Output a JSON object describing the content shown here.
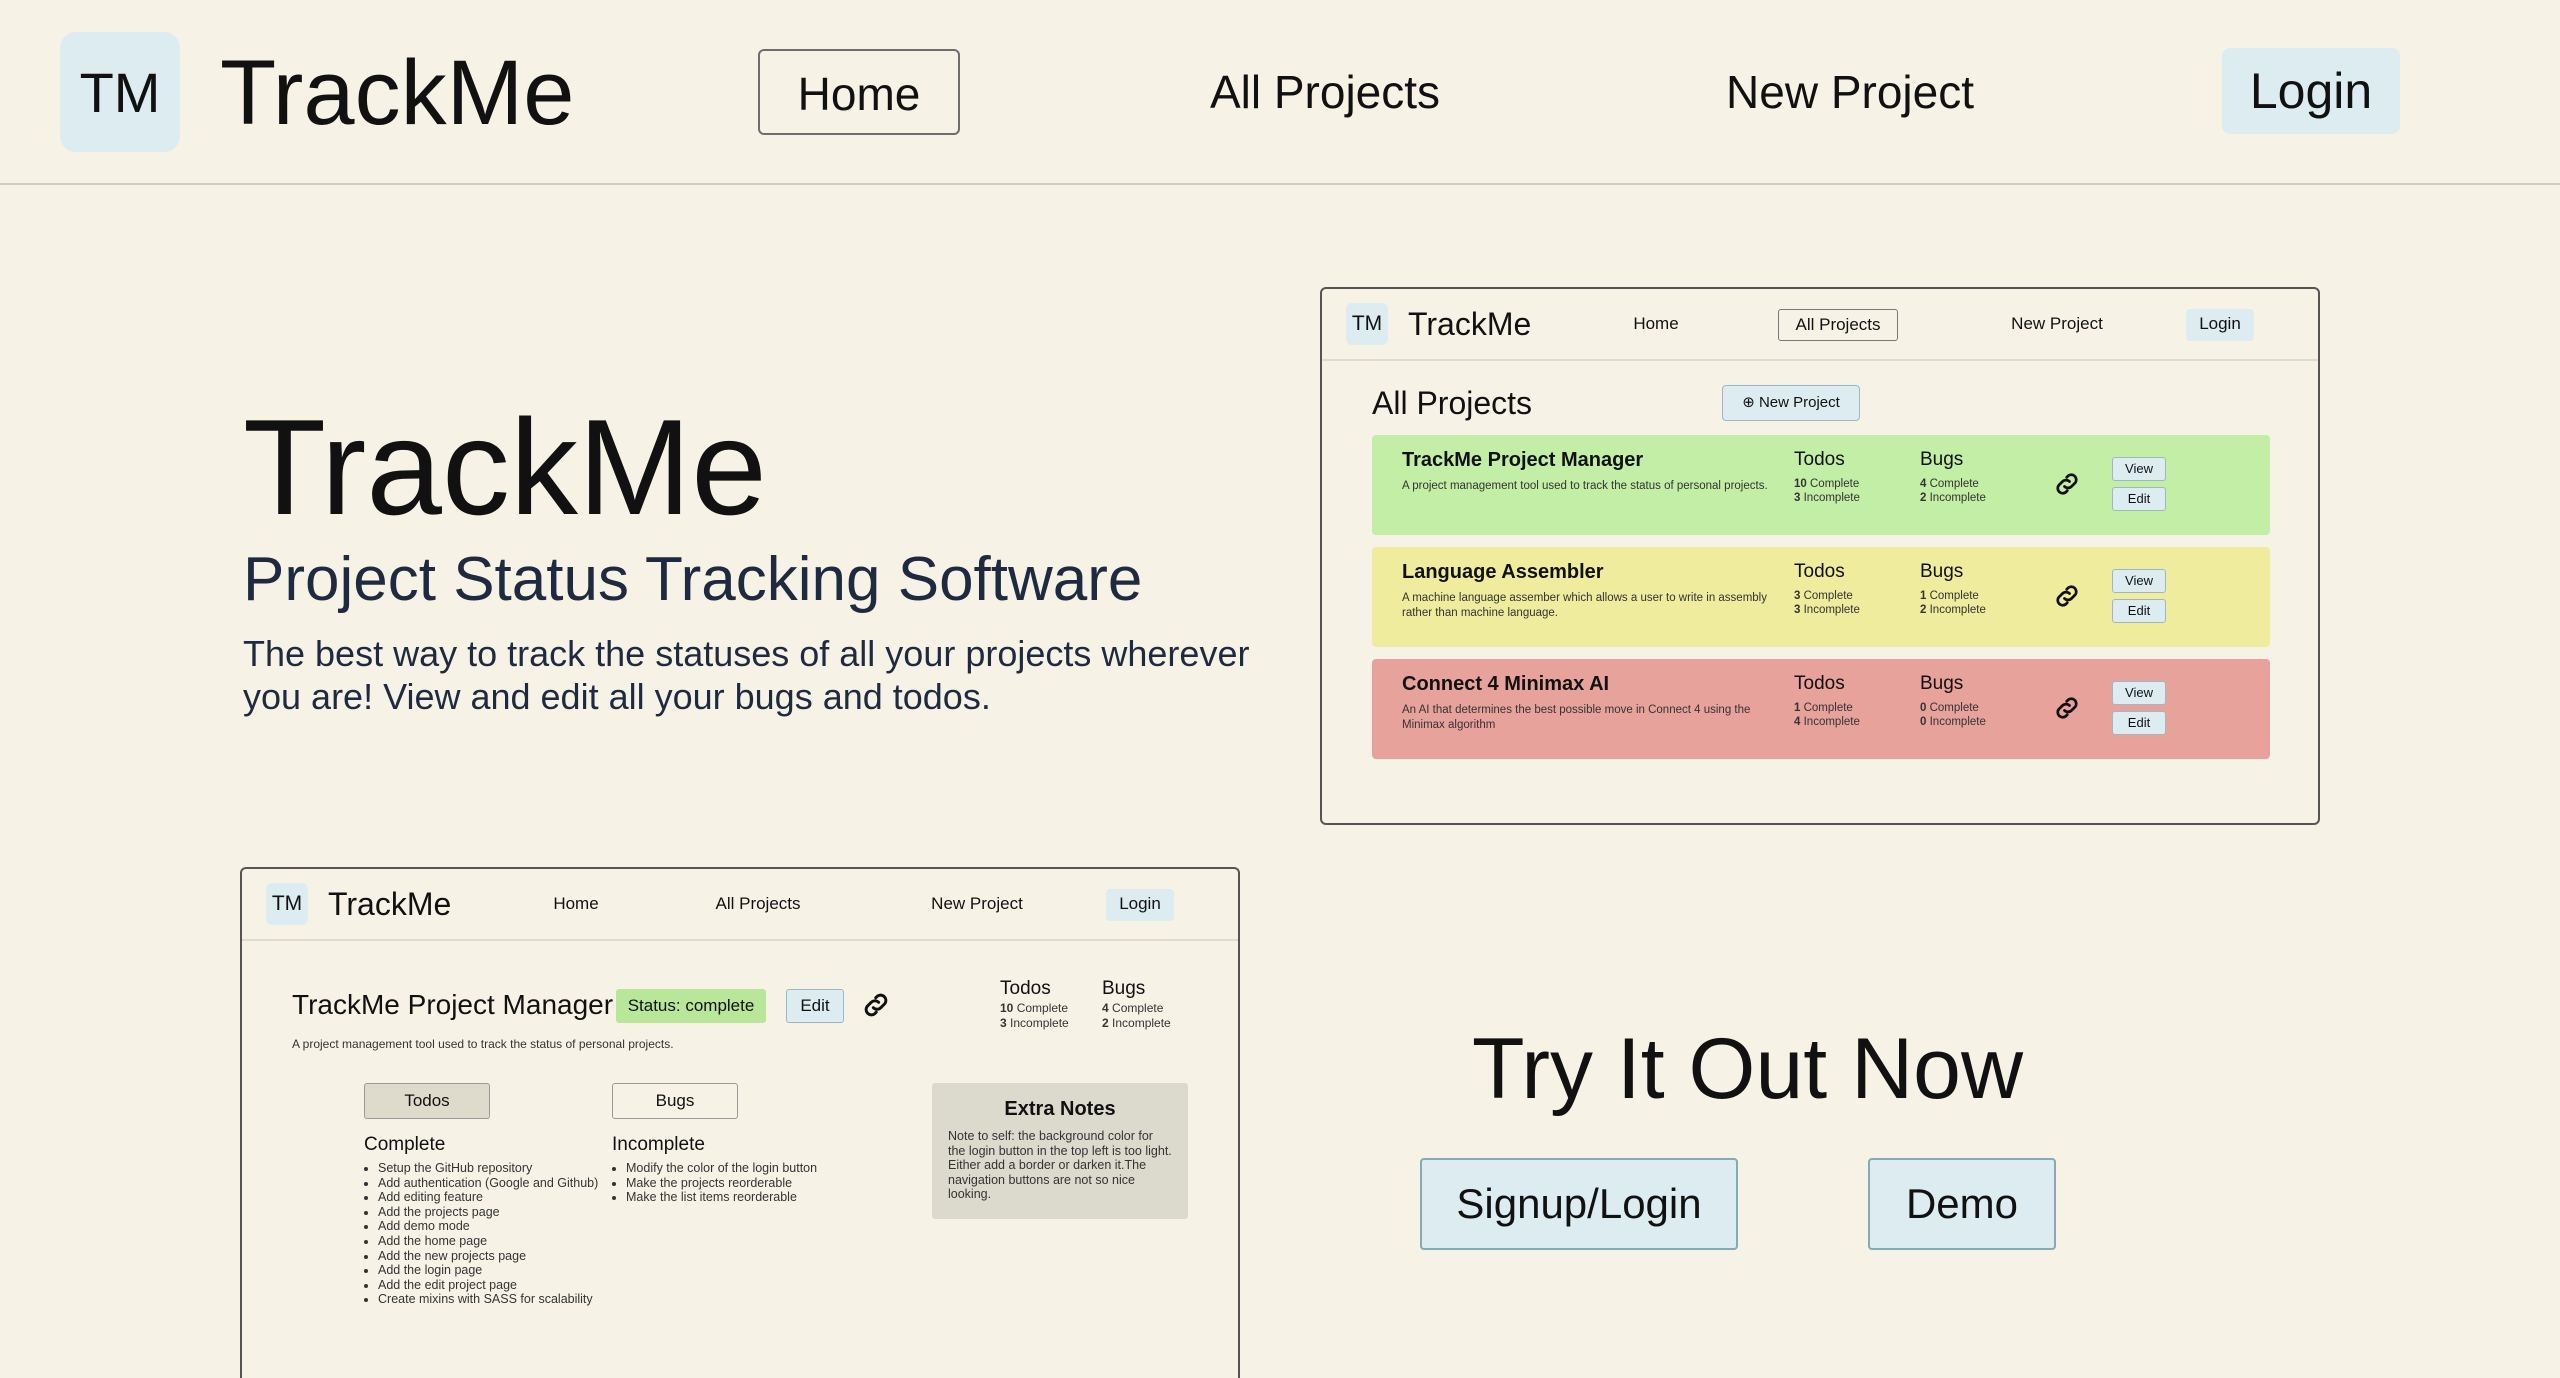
{
  "nav": {
    "logo": "TM",
    "brand": "TrackMe",
    "links": [
      "Home",
      "All Projects",
      "New Project"
    ],
    "login": "Login"
  },
  "hero": {
    "title": "TrackMe",
    "subtitle": "Project Status Tracking Software",
    "description": "The best way to track the statuses of all your projects wherever you are! View and edit all your bugs and todos."
  },
  "all_projects_preview": {
    "nav": {
      "logo": "TM",
      "brand": "TrackMe",
      "links": [
        "Home",
        "All Projects",
        "New Project"
      ],
      "login": "Login"
    },
    "title": "All Projects",
    "new_button": "New Project",
    "todos_label": "Todos",
    "bugs_label": "Bugs",
    "complete_label": "Complete",
    "incomplete_label": "Incomplete",
    "view_label": "View",
    "edit_label": "Edit",
    "projects": [
      {
        "name": "TrackMe Project Manager",
        "description": "A project management tool used to track the status of personal projects.",
        "todos_complete": "10",
        "todos_incomplete": "3",
        "bugs_complete": "4",
        "bugs_incomplete": "2",
        "color": "#c3eea5"
      },
      {
        "name": "Language Assembler",
        "description": "A machine language assember which allows a user to write in assembly rather than machine language.",
        "todos_complete": "3",
        "todos_incomplete": "3",
        "bugs_complete": "1",
        "bugs_incomplete": "2",
        "color": "#f0ec9e"
      },
      {
        "name": "Connect 4 Minimax AI",
        "description": "An AI that determines the best possible move in Connect 4 using the Minimax algorithm",
        "todos_complete": "1",
        "todos_incomplete": "4",
        "bugs_complete": "0",
        "bugs_incomplete": "0",
        "color": "#e8a29c"
      }
    ]
  },
  "project_detail_preview": {
    "nav": {
      "logo": "TM",
      "brand": "TrackMe",
      "links": [
        "Home",
        "All Projects",
        "New Project"
      ],
      "login": "Login"
    },
    "title": "TrackMe Project Manager",
    "status": "Status: complete",
    "edit": "Edit",
    "description": "A project management tool used to track the status of personal projects.",
    "todos_label": "Todos",
    "bugs_label": "Bugs",
    "todos_complete": "10",
    "todos_incomplete": "3",
    "bugs_complete": "4",
    "bugs_incomplete": "2",
    "complete_label": "Complete",
    "incomplete_label": "Incomplete",
    "tabs": [
      "Todos",
      "Bugs"
    ],
    "complete_heading": "Complete",
    "incomplete_heading": "Incomplete",
    "complete_items": [
      "Setup the GitHub repository",
      "Add authentication (Google and Github)",
      "Add editing feature",
      "Add the projects page",
      "Add demo mode",
      "Add the home page",
      "Add the new projects page",
      "Add the login page",
      "Add the edit project page",
      "Create mixins with SASS for scalability"
    ],
    "incomplete_items": [
      "Modify the color of the login button",
      "Make the projects reorderable",
      "Make the list items reorderable"
    ],
    "notes_title": "Extra Notes",
    "notes_body": "Note to self: the background color for the login button in the top left is too light. Either add a border or darken it.The navigation buttons are not so nice looking."
  },
  "cta": {
    "title": "Try It Out Now",
    "signup": "Signup/Login",
    "demo": "Demo"
  }
}
